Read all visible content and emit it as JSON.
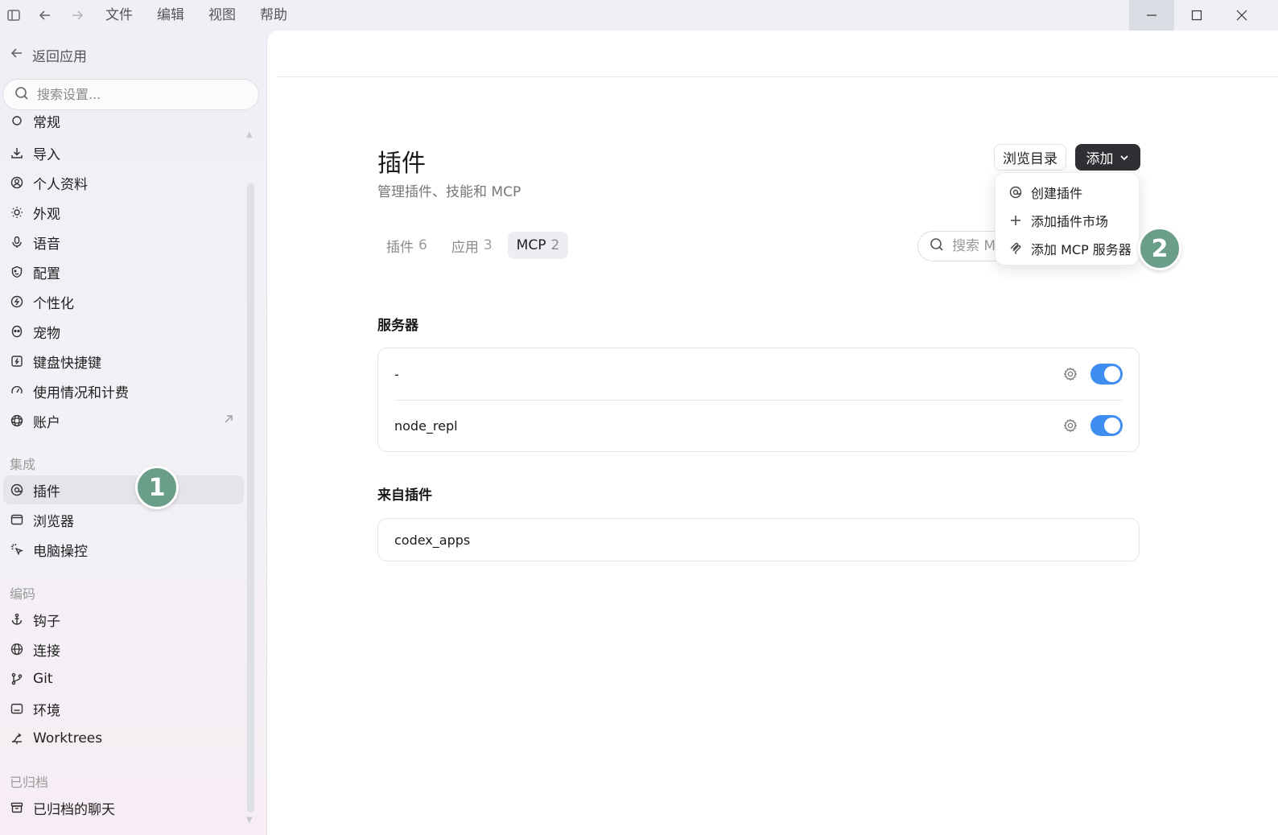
{
  "titlebar": {
    "menus": [
      "文件",
      "编辑",
      "视图",
      "帮助"
    ]
  },
  "sidebar": {
    "back_label": "返回应用",
    "search_placeholder": "搜索设置...",
    "partial_item": "常规",
    "items_general": [
      {
        "label": "导入",
        "icon": "download-icon"
      },
      {
        "label": "个人资料",
        "icon": "profile-icon"
      },
      {
        "label": "外观",
        "icon": "sun-icon"
      },
      {
        "label": "语音",
        "icon": "microphone-icon"
      },
      {
        "label": "配置",
        "icon": "config-icon"
      },
      {
        "label": "个性化",
        "icon": "personalize-icon"
      },
      {
        "label": "宠物",
        "icon": "pet-icon"
      },
      {
        "label": "键盘快捷键",
        "icon": "keyboard-icon"
      },
      {
        "label": "使用情况和计费",
        "icon": "gauge-icon"
      },
      {
        "label": "账户",
        "icon": "account-icon"
      }
    ],
    "section_integrations": "集成",
    "items_integrations": [
      {
        "label": "插件",
        "icon": "plugin-icon"
      },
      {
        "label": "浏览器",
        "icon": "browser-icon"
      },
      {
        "label": "电脑操控",
        "icon": "cursor-click-icon"
      }
    ],
    "section_coding": "编码",
    "items_coding": [
      {
        "label": "钩子",
        "icon": "anchor-icon"
      },
      {
        "label": "连接",
        "icon": "globe-icon"
      },
      {
        "label": "Git",
        "icon": "git-branch-icon"
      },
      {
        "label": "环境",
        "icon": "environment-icon"
      },
      {
        "label": "Worktrees",
        "icon": "worktree-icon"
      }
    ],
    "section_archived": "已归档",
    "items_archived": [
      {
        "label": "已归档的聊天",
        "icon": "archive-icon"
      }
    ]
  },
  "badges": {
    "one": "1",
    "two": "2"
  },
  "main": {
    "title": "插件",
    "subtitle": "管理插件、技能和 MCP",
    "browse_label": "浏览目录",
    "add_label": "添加",
    "tabs": [
      {
        "label": "插件",
        "count": "6"
      },
      {
        "label": "应用",
        "count": "3"
      },
      {
        "label": "MCP",
        "count": "2"
      }
    ],
    "search_placeholder": "搜索 MCP",
    "dropdown": [
      {
        "label": "创建插件",
        "icon": "plugin-icon"
      },
      {
        "label": "添加插件市场",
        "icon": "plus-icon"
      },
      {
        "label": "添加 MCP 服务器",
        "icon": "mcp-icon"
      }
    ],
    "servers_title": "服务器",
    "servers": [
      {
        "name": "-",
        "enabled": true
      },
      {
        "name": "node_repl",
        "enabled": true
      }
    ],
    "from_plugins_title": "来自插件",
    "from_plugins": [
      {
        "name": "codex_apps"
      }
    ]
  }
}
